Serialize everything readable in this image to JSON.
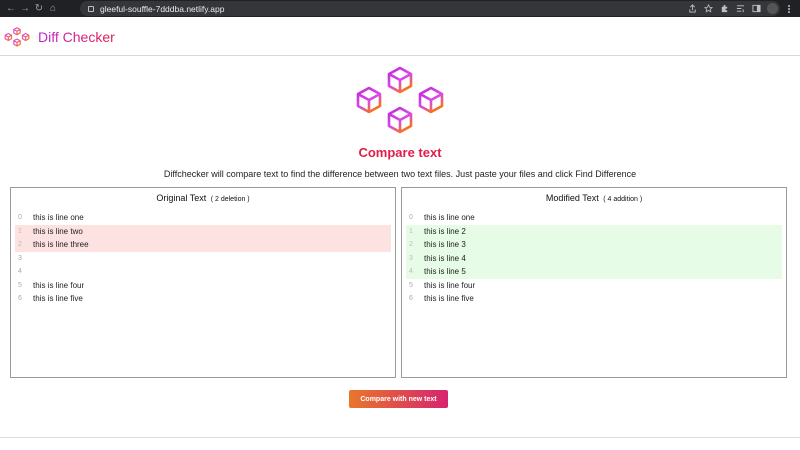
{
  "browser": {
    "url": "gleeful-souffle-7dddba.netlify.app",
    "back_glyph": "←",
    "forward_glyph": "→",
    "reload_glyph": "↻",
    "home_glyph": "⌂"
  },
  "header": {
    "brand": "Diff Checker"
  },
  "hero": {
    "title": "Compare text",
    "description": "Diffchecker will compare text to find the difference between two text files. Just paste your files and click Find Difference"
  },
  "original": {
    "title": "Original Text",
    "note": "( 2 deletion )",
    "lines": [
      {
        "num": "0",
        "text": "this is line one",
        "state": "normal"
      },
      {
        "num": "1",
        "text": "this is line two",
        "state": "del"
      },
      {
        "num": "2",
        "text": "this is line three",
        "state": "del"
      },
      {
        "num": "3",
        "text": "",
        "state": "normal"
      },
      {
        "num": "4",
        "text": "",
        "state": "normal"
      },
      {
        "num": "5",
        "text": "this is line four",
        "state": "normal"
      },
      {
        "num": "6",
        "text": "this is line five",
        "state": "normal"
      }
    ]
  },
  "modified": {
    "title": "Modified Text",
    "note": "( 4 addition )",
    "lines": [
      {
        "num": "0",
        "text": "this is line one",
        "state": "normal"
      },
      {
        "num": "1",
        "text": "this is line 2",
        "state": "add"
      },
      {
        "num": "2",
        "text": "this is line 3",
        "state": "add"
      },
      {
        "num": "3",
        "text": "this is line 4",
        "state": "add"
      },
      {
        "num": "4",
        "text": "this is line 5",
        "state": "add"
      },
      {
        "num": "5",
        "text": "this is line four",
        "state": "normal"
      },
      {
        "num": "6",
        "text": "this is line five",
        "state": "normal"
      }
    ]
  },
  "actions": {
    "compare_new": "Compare with new text"
  },
  "colors": {
    "accent": "#e11d48",
    "brand_gradient_start": "#c026d3",
    "deletion_bg": "#fde2e2",
    "addition_bg": "#e6fce6"
  },
  "icons": [
    "back-icon",
    "forward-icon",
    "reload-icon",
    "home-icon",
    "lock-icon",
    "share-icon",
    "star-icon",
    "extensions-icon",
    "reading-list-icon",
    "sidebar-icon",
    "profile-avatar",
    "menu-icon",
    "cube-logo-icon"
  ]
}
